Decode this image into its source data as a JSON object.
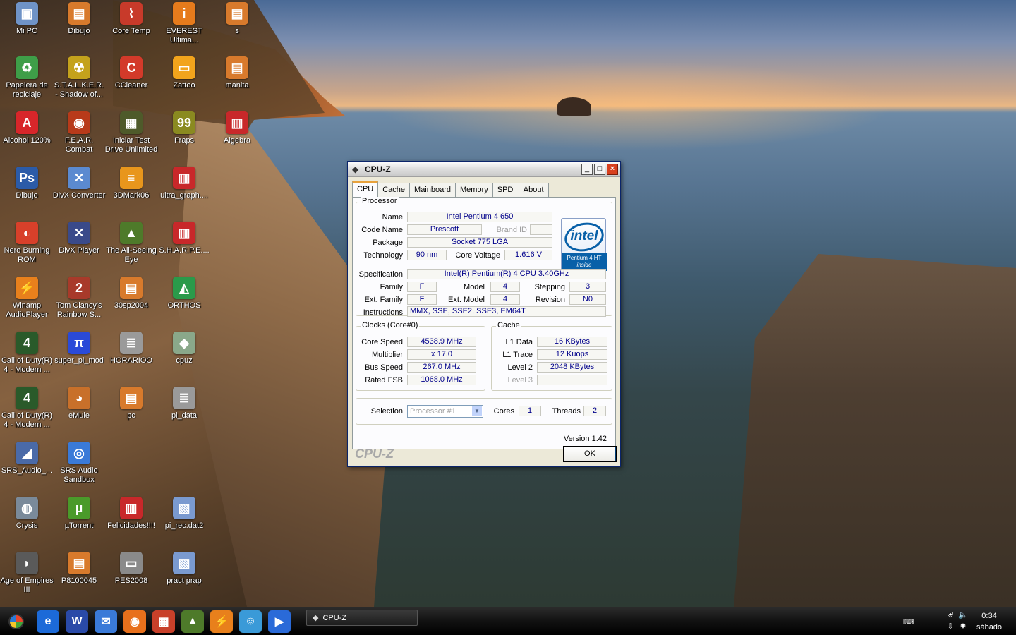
{
  "desktop": {
    "icons": [
      {
        "label": "Mi PC",
        "glyph": "▣",
        "color": "#6f93c7",
        "col": 0,
        "row": 0
      },
      {
        "label": "Dibujo",
        "glyph": "▤",
        "color": "#d87a2c",
        "col": 1,
        "row": 0
      },
      {
        "label": "Core Temp",
        "glyph": "⌇",
        "color": "#c83a2a",
        "col": 2,
        "row": 0
      },
      {
        "label": "EVEREST Ultima...",
        "glyph": "i",
        "color": "#e67b1c",
        "col": 3,
        "row": 0
      },
      {
        "label": "s",
        "glyph": "▤",
        "color": "#d87a2c",
        "col": 4,
        "row": 0
      },
      {
        "label": "Papelera de reciclaje",
        "glyph": "♻",
        "color": "#3e9e48",
        "col": 0,
        "row": 1
      },
      {
        "label": "S.T.A.L.K.E.R. - Shadow of...",
        "glyph": "☢",
        "color": "#c4a21c",
        "col": 1,
        "row": 1
      },
      {
        "label": "CCleaner",
        "glyph": "C",
        "color": "#d33a2a",
        "col": 2,
        "row": 1
      },
      {
        "label": "Zattoo",
        "glyph": "▭",
        "color": "#f2a41c",
        "col": 3,
        "row": 1
      },
      {
        "label": "manita",
        "glyph": "▤",
        "color": "#d87a2c",
        "col": 4,
        "row": 1
      },
      {
        "label": "Alcohol 120%",
        "glyph": "A",
        "color": "#d8262a",
        "col": 0,
        "row": 2
      },
      {
        "label": "F.E.A.R. Combat",
        "glyph": "◉",
        "color": "#b83a1a",
        "col": 1,
        "row": 2
      },
      {
        "label": "Iniciar Test Drive Unlimited",
        "glyph": "▦",
        "color": "#4e5a2a",
        "col": 2,
        "row": 2
      },
      {
        "label": "Fraps",
        "glyph": "99",
        "color": "#8a8a20",
        "col": 3,
        "row": 2
      },
      {
        "label": "Algebra",
        "glyph": "▥",
        "color": "#c8282a",
        "col": 4,
        "row": 2
      },
      {
        "label": "Dibujo",
        "glyph": "Ps",
        "color": "#2b5ba8",
        "col": 0,
        "row": 3
      },
      {
        "label": "DivX Converter",
        "glyph": "✕",
        "color": "#5b8ad0",
        "col": 1,
        "row": 3
      },
      {
        "label": "3DMark06",
        "glyph": "≡",
        "color": "#e8961c",
        "col": 2,
        "row": 3
      },
      {
        "label": "ultra_graph....",
        "glyph": "▥",
        "color": "#c8282a",
        "col": 3,
        "row": 3
      },
      {
        "label": "Nero Burning ROM",
        "glyph": "◐",
        "color": "#d8402a",
        "col": 0,
        "row": 4
      },
      {
        "label": "DivX Player",
        "glyph": "✕",
        "color": "#3a4a8a",
        "col": 1,
        "row": 4
      },
      {
        "label": "The All-Seeing Eye",
        "glyph": "▲",
        "color": "#4e7a2a",
        "col": 2,
        "row": 4
      },
      {
        "label": "S.H.A.R.P.E....",
        "glyph": "▥",
        "color": "#c8282a",
        "col": 3,
        "row": 4
      },
      {
        "label": "Winamp AudioPlayer",
        "glyph": "⚡",
        "color": "#e8801c",
        "col": 0,
        "row": 5
      },
      {
        "label": "Tom Clancy's Rainbow S...",
        "glyph": "2",
        "color": "#a83a2a",
        "col": 1,
        "row": 5
      },
      {
        "label": "30sp2004",
        "glyph": "▤",
        "color": "#d87a2c",
        "col": 2,
        "row": 5
      },
      {
        "label": "ORTHOS",
        "glyph": "◭",
        "color": "#2a9a4a",
        "col": 3,
        "row": 5
      },
      {
        "label": "Call of Duty(R) 4 - Modern ...",
        "glyph": "4",
        "color": "#2a5a2a",
        "col": 0,
        "row": 6
      },
      {
        "label": "super_pi_mod",
        "glyph": "π",
        "color": "#2a4ad8",
        "col": 1,
        "row": 6
      },
      {
        "label": "HORARIOO",
        "glyph": "≣",
        "color": "#9a9a9a",
        "col": 2,
        "row": 6
      },
      {
        "label": "cpuz",
        "glyph": "◆",
        "color": "#8aa88a",
        "col": 3,
        "row": 6
      },
      {
        "label": "Call of Duty(R) 4 - Modern ...",
        "glyph": "4",
        "color": "#2a5a2a",
        "col": 0,
        "row": 7
      },
      {
        "label": "eMule",
        "glyph": "◕",
        "color": "#c8702a",
        "col": 1,
        "row": 7
      },
      {
        "label": "pc",
        "glyph": "▤",
        "color": "#d87a2c",
        "col": 2,
        "row": 7
      },
      {
        "label": "pi_data",
        "glyph": "≣",
        "color": "#9a9a9a",
        "col": 3,
        "row": 7
      },
      {
        "label": "SRS_Audio_...",
        "glyph": "◢",
        "color": "#4a6aa8",
        "col": 0,
        "row": 8
      },
      {
        "label": "SRS Audio Sandbox",
        "glyph": "◎",
        "color": "#3a7ad8",
        "col": 1,
        "row": 8
      },
      {
        "label": "Crysis",
        "glyph": "◍",
        "color": "#7a8a9a",
        "col": 0,
        "row": 9
      },
      {
        "label": "µTorrent",
        "glyph": "µ",
        "color": "#4a9a2a",
        "col": 1,
        "row": 9
      },
      {
        "label": "Felicidades!!!!",
        "glyph": "▥",
        "color": "#c8282a",
        "col": 2,
        "row": 9
      },
      {
        "label": "pi_rec.dat2",
        "glyph": "▧",
        "color": "#7a9ad0",
        "col": 3,
        "row": 9
      },
      {
        "label": "Age of Empires III",
        "glyph": "◗",
        "color": "#5a5a5a",
        "col": 0,
        "row": 10
      },
      {
        "label": "P8100045",
        "glyph": "▤",
        "color": "#d87a2c",
        "col": 1,
        "row": 10
      },
      {
        "label": "PES2008",
        "glyph": "▭",
        "color": "#8a8a8a",
        "col": 2,
        "row": 10
      },
      {
        "label": "pract prap",
        "glyph": "▧",
        "color": "#7a9ad0",
        "col": 3,
        "row": 10
      }
    ]
  },
  "window": {
    "title": "CPU-Z",
    "tabs": [
      "CPU",
      "Cache",
      "Mainboard",
      "Memory",
      "SPD",
      "About"
    ],
    "active_tab": "CPU",
    "processor": {
      "group_title": "Processor",
      "name_label": "Name",
      "name": "Intel Pentium 4 650",
      "codename_label": "Code Name",
      "codename": "Prescott",
      "brandid_label": "Brand ID",
      "brandid": "",
      "package_label": "Package",
      "package": "Socket 775 LGA",
      "technology_label": "Technology",
      "technology": "90 nm",
      "voltage_label": "Core Voltage",
      "voltage": "1.616 V",
      "spec_label": "Specification",
      "spec": "Intel(R) Pentium(R) 4 CPU 3.40GHz",
      "family_label": "Family",
      "family": "F",
      "model_label": "Model",
      "model": "4",
      "stepping_label": "Stepping",
      "stepping": "3",
      "extfamily_label": "Ext. Family",
      "extfamily": "F",
      "extmodel_label": "Ext. Model",
      "extmodel": "4",
      "revision_label": "Revision",
      "revision": "N0",
      "instructions_label": "Instructions",
      "instructions": "MMX, SSE, SSE2, SSE3, EM64T"
    },
    "logo": {
      "word": "intel",
      "sub_line1": "Pentium 4 HT",
      "sub_line2": "inside"
    },
    "clocks": {
      "group_title": "Clocks (Core#0)",
      "core_speed_label": "Core Speed",
      "core_speed": "4538.9 MHz",
      "multiplier_label": "Multiplier",
      "multiplier": "x 17.0",
      "bus_speed_label": "Bus Speed",
      "bus_speed": "267.0 MHz",
      "rated_fsb_label": "Rated FSB",
      "rated_fsb": "1068.0 MHz"
    },
    "cache": {
      "group_title": "Cache",
      "l1data_label": "L1 Data",
      "l1data": "16 KBytes",
      "l1trace_label": "L1 Trace",
      "l1trace": "12 Kuops",
      "level2_label": "Level 2",
      "level2": "2048 KBytes",
      "level3_label": "Level 3",
      "level3": ""
    },
    "selection": {
      "label": "Selection",
      "value": "Processor #1",
      "cores_label": "Cores",
      "cores": "1",
      "threads_label": "Threads",
      "threads": "2"
    },
    "version": "Version 1.42",
    "brand": "CPU-Z",
    "ok_label": "OK"
  },
  "taskbar": {
    "quick_launch": [
      {
        "name": "ie",
        "glyph": "e",
        "color": "#1c6ad8"
      },
      {
        "name": "word",
        "glyph": "W",
        "color": "#2a4aa8"
      },
      {
        "name": "outlook",
        "glyph": "✉",
        "color": "#3a7ad8"
      },
      {
        "name": "firefox",
        "glyph": "◉",
        "color": "#e8701c"
      },
      {
        "name": "app-red",
        "glyph": "▦",
        "color": "#c8402a"
      },
      {
        "name": "all-seeing-eye",
        "glyph": "▲",
        "color": "#4e7a2a"
      },
      {
        "name": "winamp",
        "glyph": "⚡",
        "color": "#e8801c"
      },
      {
        "name": "messenger",
        "glyph": "☺",
        "color": "#3a9ad8"
      },
      {
        "name": "media-player",
        "glyph": "▶",
        "color": "#2a6ad8"
      }
    ],
    "active_task": "CPU-Z",
    "clock_time": "0:34",
    "clock_day": "sábado"
  }
}
